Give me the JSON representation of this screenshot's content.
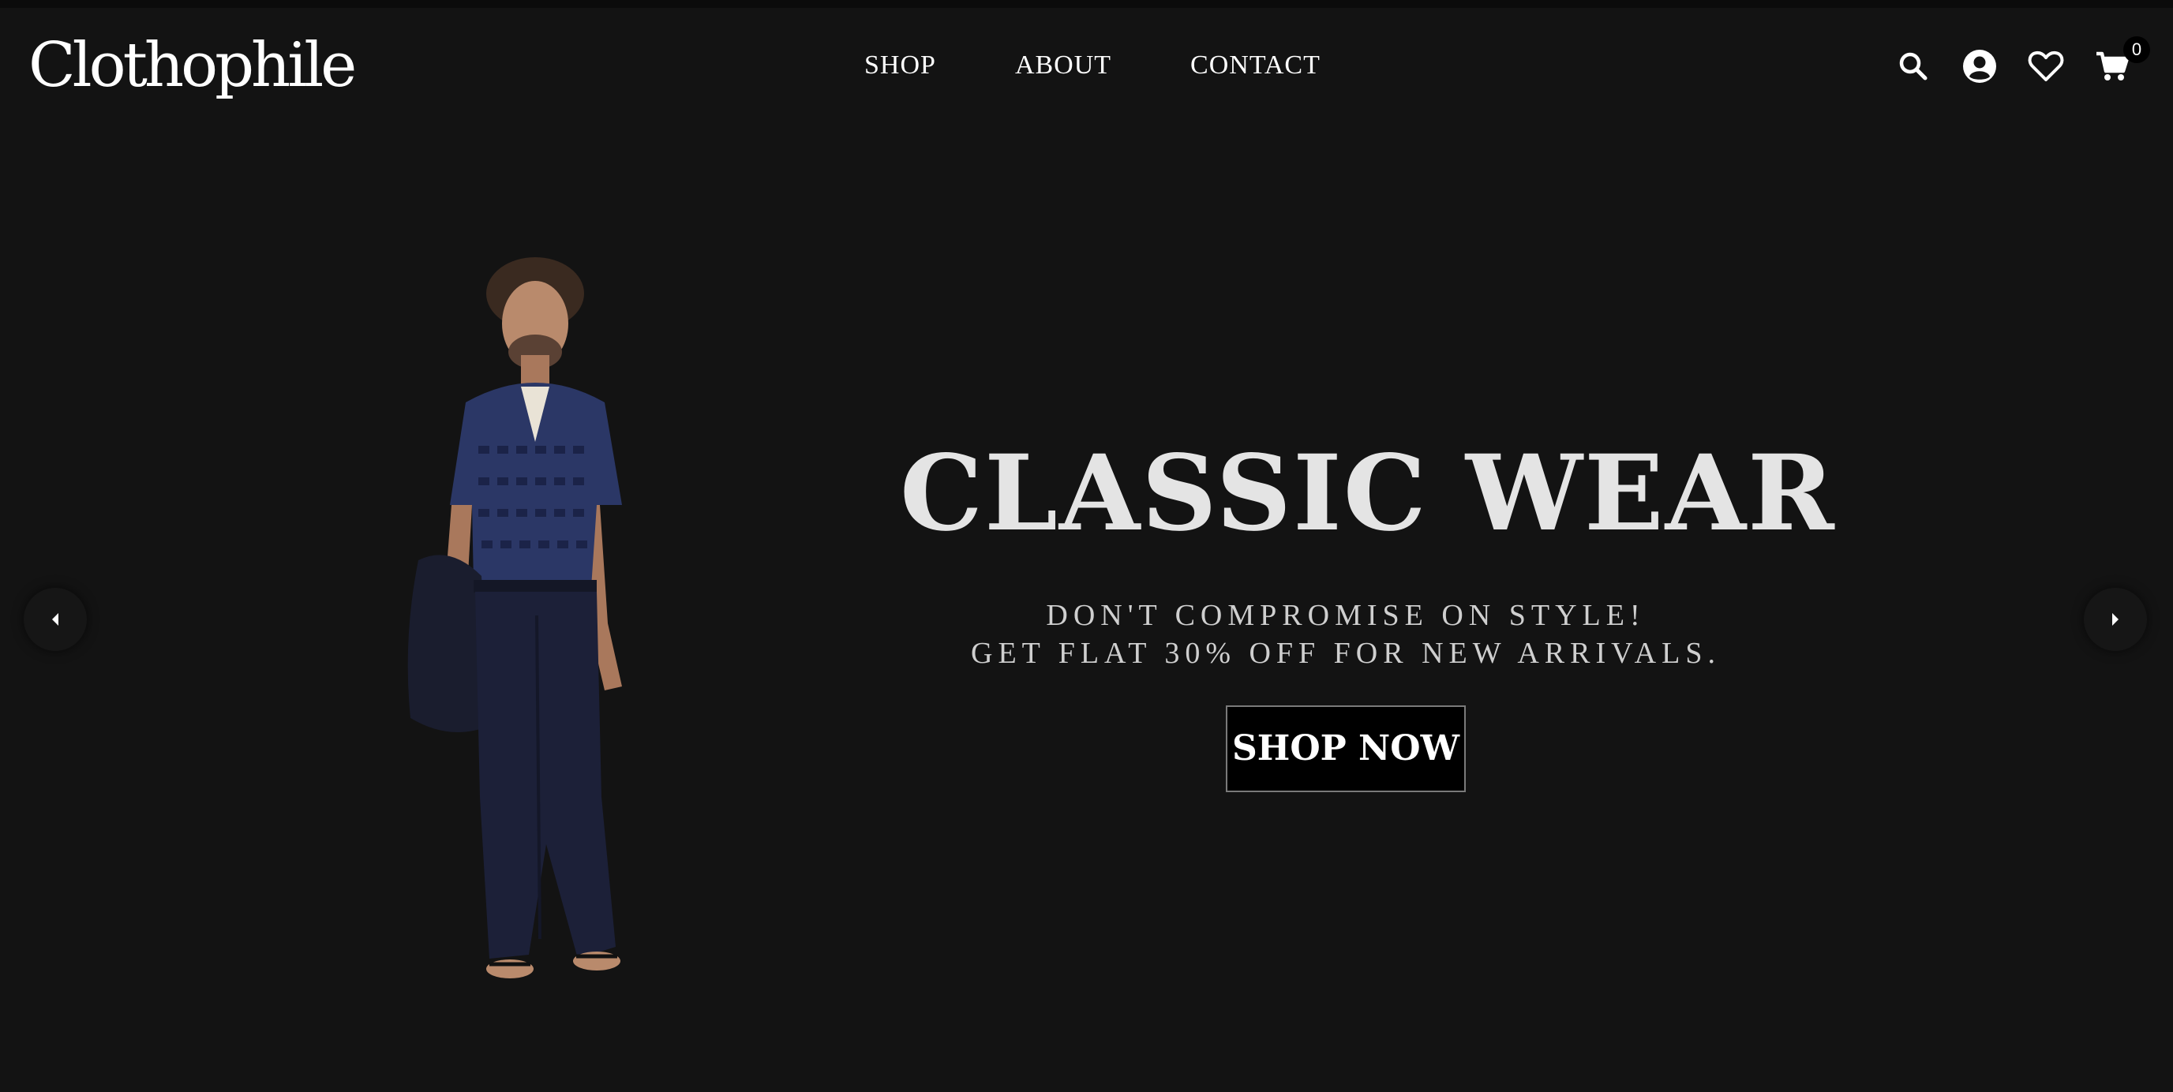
{
  "brand": {
    "logo_text": "Clothophile"
  },
  "nav": {
    "items": [
      "SHOP",
      "ABOUT",
      "CONTACT"
    ]
  },
  "header_icons": {
    "search": "search-icon",
    "account": "user-circle-icon",
    "wishlist": "heart-icon",
    "cart": "cart-icon",
    "cart_count": "0"
  },
  "hero": {
    "title": "CLASSIC WEAR",
    "subtitle_line1": "DON'T COMPROMISE ON STYLE!",
    "subtitle_line2": "GET FLAT 30% OFF FOR NEW ARRIVALS.",
    "cta_label": "SHOP NOW",
    "image_alt": "Model in navy knit shirt and trousers"
  },
  "carousel": {
    "prev_icon": "caret-left-icon",
    "next_icon": "caret-right-icon"
  },
  "colors": {
    "background": "#131313",
    "title": "#e4e4e4",
    "shirt": "#2b3766",
    "trousers": "#1c2038"
  }
}
